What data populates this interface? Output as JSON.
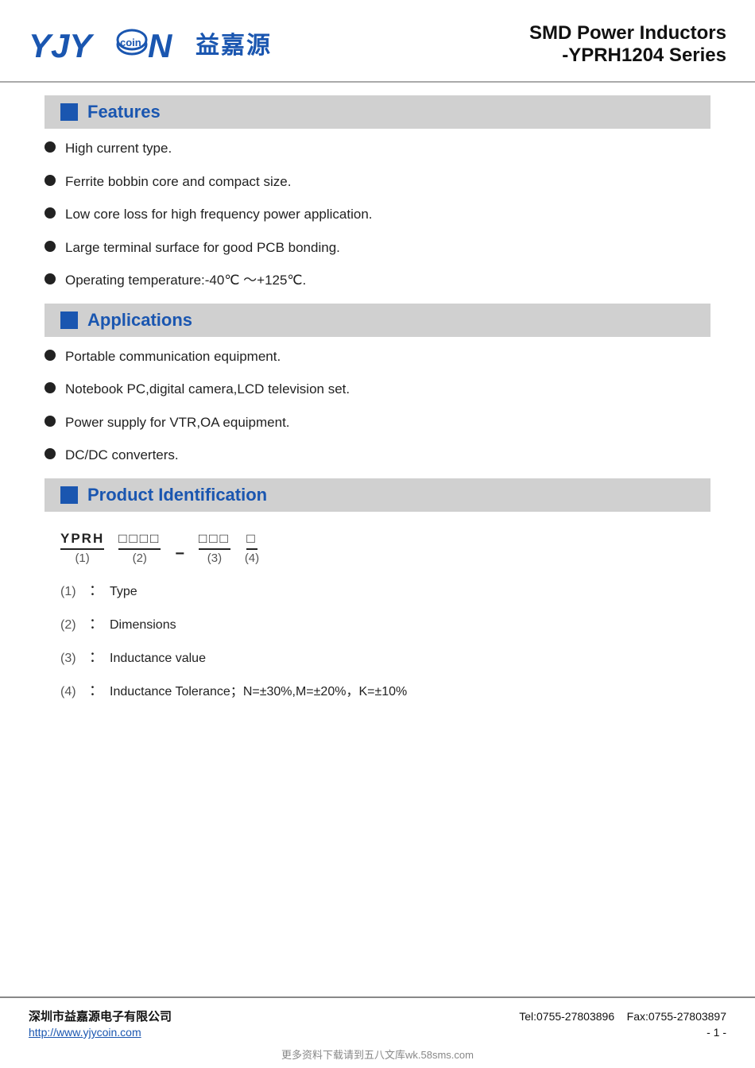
{
  "header": {
    "logo_text_en": "YJYCOIN",
    "logo_text_cn": "益嘉源",
    "title_line1": "SMD Power Inductors",
    "title_line2": "-YPRH1204 Series"
  },
  "sections": {
    "features": {
      "label": "Features",
      "items": [
        "High current type.",
        "Ferrite bobbin core and compact size.",
        "Low core loss for high frequency power application.",
        "Large terminal surface for good PCB bonding.",
        "Operating temperature:-40℃ ～+125℃."
      ]
    },
    "applications": {
      "label": "Applications",
      "items": [
        "Portable communication equipment.",
        "Notebook PC,digital camera,LCD television set.",
        "Power supply for VTR,OA equipment.",
        "DC/DC converters."
      ]
    },
    "product_id": {
      "label": "Product Identification",
      "diagram": {
        "code": "YPRH",
        "code_label": "(1)",
        "boxes1": "□□□□",
        "boxes1_label": "(2)",
        "boxes2": "□□□",
        "boxes2_label": "(3)",
        "box3": "□",
        "box3_label": "(4)"
      },
      "details": [
        {
          "num": "(1)",
          "sep": "：",
          "val": "Type"
        },
        {
          "num": "(2)",
          "sep": "：",
          "val": "Dimensions"
        },
        {
          "num": "(3)",
          "sep": "：",
          "val": "Inductance value"
        },
        {
          "num": "(4)",
          "sep": "：",
          "val": "Inductance Tolerance；N=±30%,M=±20%，K=±10%"
        }
      ]
    }
  },
  "footer": {
    "company": "深圳市益嘉源电子有限公司",
    "tel": "Tel:0755-27803896",
    "fax": "Fax:0755-27803897",
    "website": "http://www.yjycoin.com",
    "page": "- 1 -",
    "watermark": "更多资料下载请到五八文库wk.58sms.com"
  }
}
